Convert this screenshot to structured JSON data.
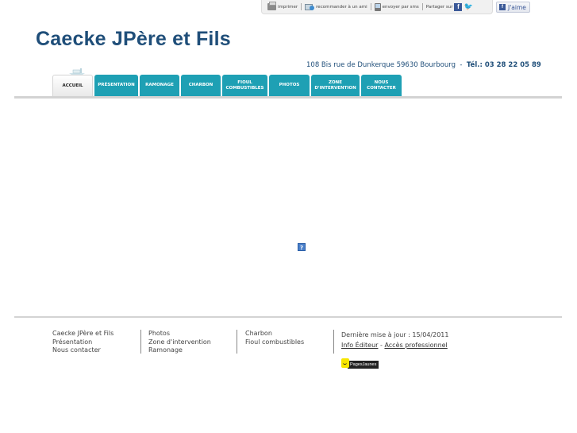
{
  "toolbar": {
    "print": "imprimer",
    "recommend": "recommander à un ami",
    "sms": "envoyer par sms",
    "share": "Partager sur",
    "like": "J'aime"
  },
  "header": {
    "title": "Caecke JPère et Fils",
    "address": "108 Bis rue de Dunkerque 59630 Bourbourg",
    "tel_label": "Tél.: 03 28 22 05 89"
  },
  "nav": [
    {
      "label": "Accueil",
      "active": true
    },
    {
      "label": "Présentation"
    },
    {
      "label": "Ramonage"
    },
    {
      "label": "Charbon"
    },
    {
      "label": "Fioul combustibles"
    },
    {
      "label": "Photos"
    },
    {
      "label": "Zone d'intervention"
    },
    {
      "label": "Nous contacter"
    }
  ],
  "content": {
    "help_glyph": "?"
  },
  "footer": {
    "col1": [
      "Caecke JPère et Fils",
      "Présentation",
      "Nous contacter"
    ],
    "col2": [
      "Photos",
      "Zone d'intervention",
      "Ramonage"
    ],
    "col3": [
      "Charbon",
      "Fioul combustibles"
    ],
    "updated": "Dernière mise à jour : 15/04/2011",
    "info_editeur": "Info Éditeur",
    "separator": "-",
    "pro_access": "Accès professionnel",
    "pagesjaunes": "PagesJaunes"
  }
}
